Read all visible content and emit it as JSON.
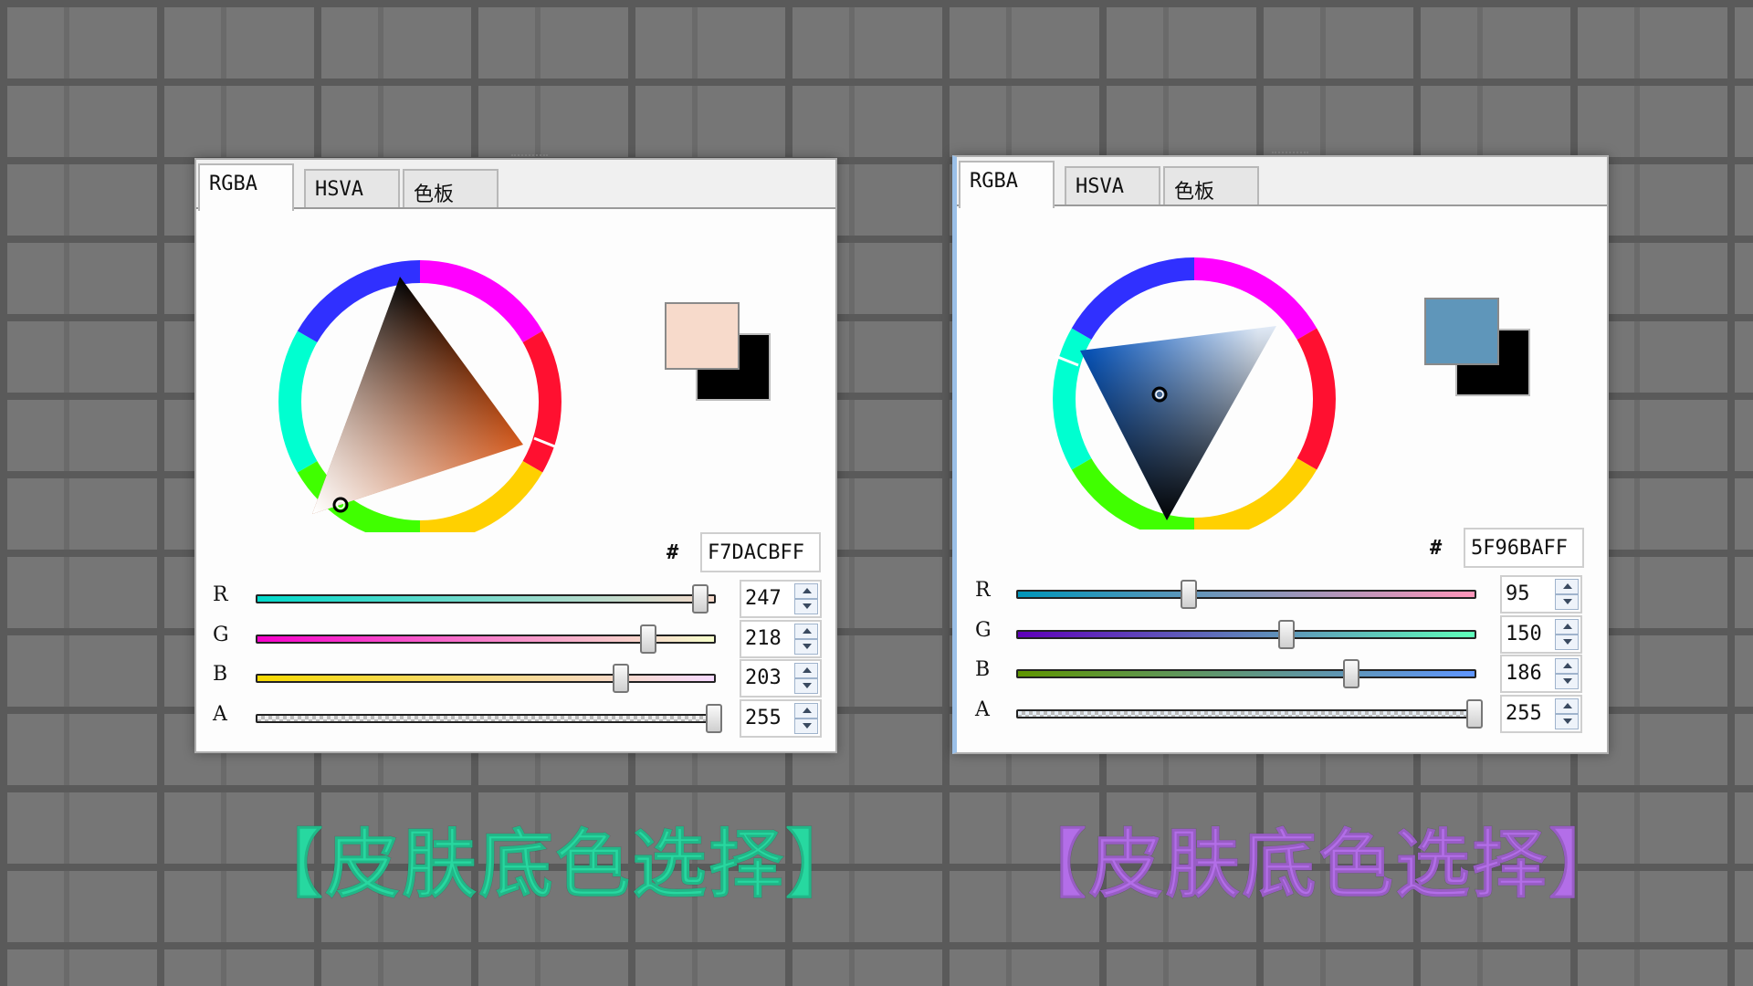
{
  "pickers": [
    {
      "tabs": [
        "RGBA",
        "HSVA",
        "色板"
      ],
      "active_tab": "RGBA",
      "hex_prefix": "#",
      "hex": "F7DACBFF",
      "current_color": "#f7dacb",
      "previous_color": "#000000",
      "hue_marker_color": "#f06020",
      "channels": [
        {
          "label": "R",
          "value": "247",
          "level": 0.969
        },
        {
          "label": "G",
          "value": "218",
          "level": 0.855
        },
        {
          "label": "B",
          "value": "203",
          "level": 0.796
        },
        {
          "label": "A",
          "value": "255",
          "level": 1.0
        }
      ]
    },
    {
      "tabs": [
        "RGBA",
        "HSVA",
        "色板"
      ],
      "active_tab": "RGBA",
      "hex_prefix": "#",
      "hex": "5F96BAFF",
      "current_color": "#5f96ba",
      "previous_color": "#000000",
      "hue_marker_color": "#1a8cff",
      "channels": [
        {
          "label": "R",
          "value": "95",
          "level": 0.373
        },
        {
          "label": "G",
          "value": "150",
          "level": 0.588
        },
        {
          "label": "B",
          "value": "186",
          "level": 0.729
        },
        {
          "label": "A",
          "value": "255",
          "level": 1.0
        }
      ]
    }
  ],
  "captions": [
    {
      "text": "【皮肤底色选择】",
      "color": "#27d8a0"
    },
    {
      "text": "【皮肤底色选择】",
      "color": "#b36ee8"
    }
  ]
}
